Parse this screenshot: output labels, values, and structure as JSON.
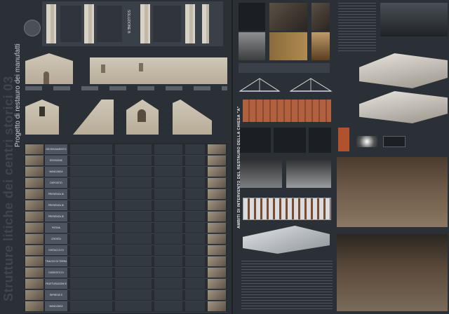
{
  "left_sheet": {
    "big_title": "Strutture litiche dei centri storici 03",
    "subtitle": "Progetto di restauro dei manufatti",
    "solution_label": "SOLUZIONE B",
    "table_rows": [
      "DEGRADAMENTO",
      "EROSIONE",
      "MANCANZA",
      "DEPOSITO SUPERFICIALE",
      "PRESENZA DI VEGETAZIONE",
      "PRESENZA DI VEGETAZIONE INFESTANTE",
      "PRESENZA DI VEGETAZIONE E ORGANISMI",
      "PATINA",
      "CROSTA",
      "DISTACCO DI ELEMENTI",
      "TRACCE DI TERRA",
      "DISSESTO DI MURATURA",
      "FRATTURAZIONI E FESSURAZIONI",
      "RIPRESE E SUPERFICI DI MALTA",
      "MANCANZA"
    ]
  },
  "right_sheet": {
    "title": "AMBITI DI INTERVENTO DEL RESTAURO DELLA CHIESA \"A\""
  },
  "colors": {
    "background": "#2b3036",
    "stone": "#cfc7b7",
    "roof": "#a95c3b"
  }
}
